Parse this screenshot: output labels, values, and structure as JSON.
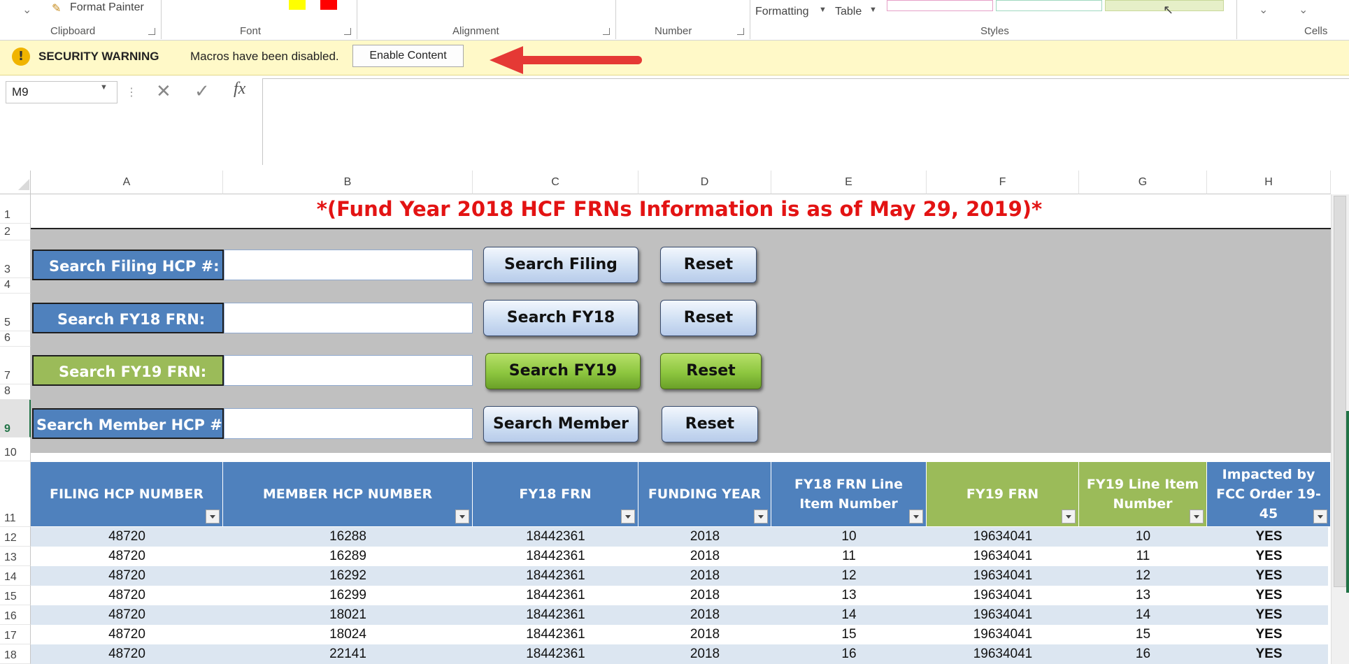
{
  "ribbon": {
    "format_painter": "Format Painter",
    "groups": [
      "Clipboard",
      "Font",
      "Alignment",
      "Number",
      "Styles",
      "Cells"
    ],
    "formatting_label": "Formatting",
    "table_label": "Table",
    "colors": {
      "highlight": "#ffff00",
      "font_color": "#ff0000"
    }
  },
  "security_bar": {
    "icon_text": "!",
    "title": "SECURITY WARNING",
    "message": "Macros have been disabled.",
    "button": "Enable Content",
    "background": "#fff9c8"
  },
  "formula_bar": {
    "name_box": "M9",
    "fx_label": "fx",
    "cancel_glyph": "✕",
    "enter_glyph": "✓",
    "value": ""
  },
  "columns": [
    "A",
    "B",
    "C",
    "D",
    "E",
    "F",
    "G",
    "H"
  ],
  "rows": [
    "1",
    "2",
    "3",
    "4",
    "5",
    "6",
    "7",
    "8",
    "9",
    "10",
    "11",
    "12",
    "13",
    "14",
    "15",
    "16",
    "17",
    "18"
  ],
  "active_row": "9",
  "title_banner": "*(Fund Year 2018 HCF FRNs Information is as of May 29, 2019)*",
  "search": [
    {
      "label": "Search Filing HCP #:",
      "button": "Search Filing",
      "reset": "Reset",
      "style": "blue"
    },
    {
      "label": "Search FY18 FRN:",
      "button": "Search FY18",
      "reset": "Reset",
      "style": "blue"
    },
    {
      "label": "Search FY19 FRN:",
      "button": "Search FY19",
      "reset": "Reset",
      "style": "green"
    },
    {
      "label": "Search Member HCP #:",
      "button": "Search Member",
      "reset": "Reset",
      "style": "blue"
    }
  ],
  "table": {
    "headers": [
      "FILING HCP NUMBER",
      "MEMBER HCP NUMBER",
      "FY18 FRN",
      "FUNDING YEAR",
      "FY18 FRN Line Item Number",
      "FY19 FRN",
      "FY19 Line Item Number",
      "Impacted by FCC Order 19-45"
    ],
    "rows": [
      [
        "48720",
        "16288",
        "18442361",
        "2018",
        "10",
        "19634041",
        "10",
        "YES"
      ],
      [
        "48720",
        "16289",
        "18442361",
        "2018",
        "11",
        "19634041",
        "11",
        "YES"
      ],
      [
        "48720",
        "16292",
        "18442361",
        "2018",
        "12",
        "19634041",
        "12",
        "YES"
      ],
      [
        "48720",
        "16299",
        "18442361",
        "2018",
        "13",
        "19634041",
        "13",
        "YES"
      ],
      [
        "48720",
        "18021",
        "18442361",
        "2018",
        "14",
        "19634041",
        "14",
        "YES"
      ],
      [
        "48720",
        "18024",
        "18442361",
        "2018",
        "15",
        "19634041",
        "15",
        "YES"
      ],
      [
        "48720",
        "22141",
        "18442361",
        "2018",
        "16",
        "19634041",
        "16",
        "YES"
      ]
    ]
  },
  "colors": {
    "header_blue": "#4f81bd",
    "header_green": "#9bbb59",
    "band": "#dce6f1",
    "title_red": "#e31313",
    "panel_gray": "#c0c0c0"
  }
}
